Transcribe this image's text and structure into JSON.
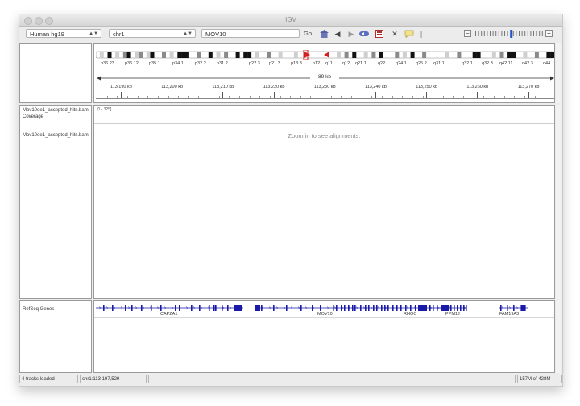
{
  "window": {
    "title": "IGV"
  },
  "toolbar": {
    "genome": "Human hg19",
    "chromosome": "chr1",
    "locus": "MOV10",
    "go_label": "Go"
  },
  "ideogram": {
    "bands": [
      "p36.23",
      "p36.12",
      "p35.1",
      "p34.1",
      "p32.2",
      "p31.2",
      "p22.3",
      "p21.3",
      "p13.3",
      "p12",
      "q11",
      "q12",
      "q21.1",
      "q22",
      "q24.1",
      "q25.2",
      "q31.1",
      "q32.1",
      "q32.3",
      "q42.11",
      "q42.3",
      "q44"
    ]
  },
  "ruler": {
    "span": "89 kb",
    "ticks": [
      "113,190 kb",
      "113,200 kb",
      "113,210 kb",
      "113,220 kb",
      "113,230 kb",
      "113,240 kb",
      "113,250 kb",
      "113,260 kb",
      "113,270 kb"
    ]
  },
  "tracks": {
    "coverage_name": "Mov10oe1_accepted_hits.bam Coverage",
    "alignment_name": "Mov10oe1_accepted_hits.bam",
    "range_label": "[0 - 325]",
    "zoom_message": "Zoom in to see alignments.",
    "genes_name": "RefSeq Genes"
  },
  "genes": [
    "CAPZA1",
    "MOV10",
    "RHOC",
    "PPM1J",
    "FAM19A3"
  ],
  "status": {
    "tracks_loaded": "4 tracks loaded",
    "position": "chr1:113,197,529",
    "message": "",
    "memory": "157M of 428M"
  },
  "colors": {
    "gene": "#1a1aa6",
    "centromere": "#d22020",
    "accent": "#2255cc"
  }
}
